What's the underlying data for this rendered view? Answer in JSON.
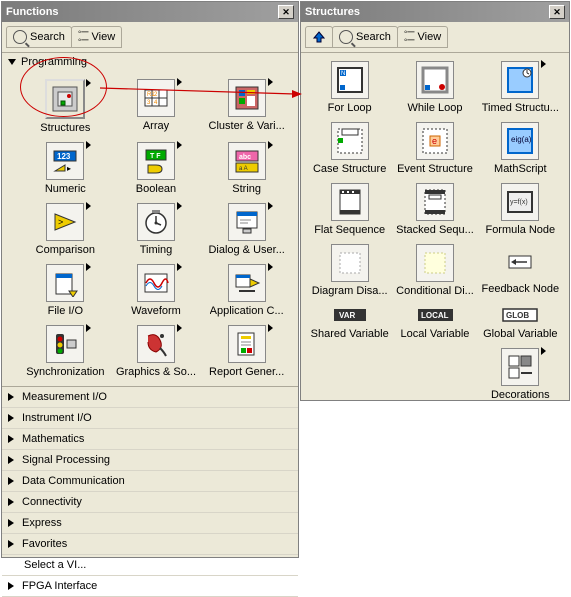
{
  "functions": {
    "title": "Functions",
    "toolbar": {
      "search": "Search",
      "view": "View"
    },
    "programming": {
      "label": "Programming",
      "items": [
        {
          "label": "Structures"
        },
        {
          "label": "Array"
        },
        {
          "label": "Cluster & Vari..."
        },
        {
          "label": "Numeric"
        },
        {
          "label": "Boolean"
        },
        {
          "label": "String"
        },
        {
          "label": "Comparison"
        },
        {
          "label": "Timing"
        },
        {
          "label": "Dialog & User..."
        },
        {
          "label": "File I/O"
        },
        {
          "label": "Waveform"
        },
        {
          "label": "Application C..."
        },
        {
          "label": "Synchronization"
        },
        {
          "label": "Graphics & So..."
        },
        {
          "label": "Report Gener..."
        }
      ]
    },
    "categories": [
      "Measurement I/O",
      "Instrument I/O",
      "Mathematics",
      "Signal Processing",
      "Data Communication",
      "Connectivity",
      "Express",
      "Favorites",
      "Select a VI...",
      "FPGA Interface"
    ]
  },
  "structures": {
    "title": "Structures",
    "toolbar": {
      "search": "Search",
      "view": "View"
    },
    "items": [
      {
        "label": "For Loop"
      },
      {
        "label": "While Loop"
      },
      {
        "label": "Timed Structu..."
      },
      {
        "label": "Case Structure"
      },
      {
        "label": "Event Structure"
      },
      {
        "label": "MathScript"
      },
      {
        "label": "Flat Sequence"
      },
      {
        "label": "Stacked Sequ..."
      },
      {
        "label": "Formula Node"
      },
      {
        "label": "Diagram Disa..."
      },
      {
        "label": "Conditional Di..."
      },
      {
        "label": "Feedback Node"
      },
      {
        "label": "Shared Variable"
      },
      {
        "label": "Local Variable"
      },
      {
        "label": "Global Variable"
      },
      {
        "label": "Decorations"
      }
    ]
  }
}
